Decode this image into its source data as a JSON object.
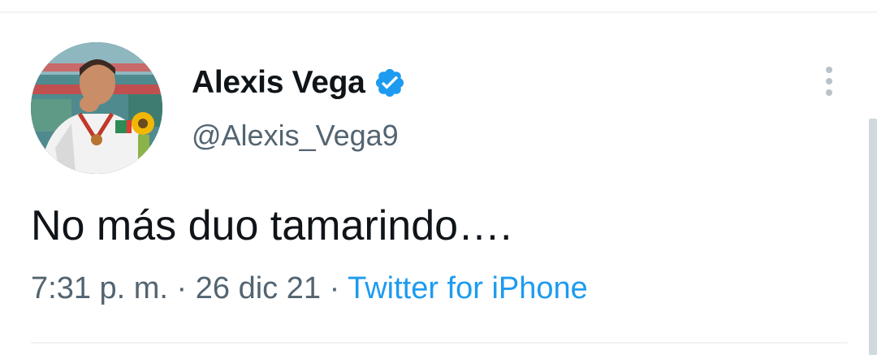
{
  "tweet": {
    "author": {
      "display_name": "Alexis Vega",
      "handle": "@Alexis_Vega9",
      "verified": true,
      "avatar_icon": "profile-photo"
    },
    "text": "No más duo tamarindo….",
    "time": "7:31 p. m.",
    "date": "26 dic 21",
    "separator": "·",
    "source": "Twitter for iPhone",
    "more_icon": "more-vertical-icon"
  },
  "colors": {
    "verified": "#1d9bf0",
    "link": "#1d9bf0",
    "secondary_text": "#536471",
    "primary_text": "#0f1419",
    "divider": "#eff3f4"
  }
}
